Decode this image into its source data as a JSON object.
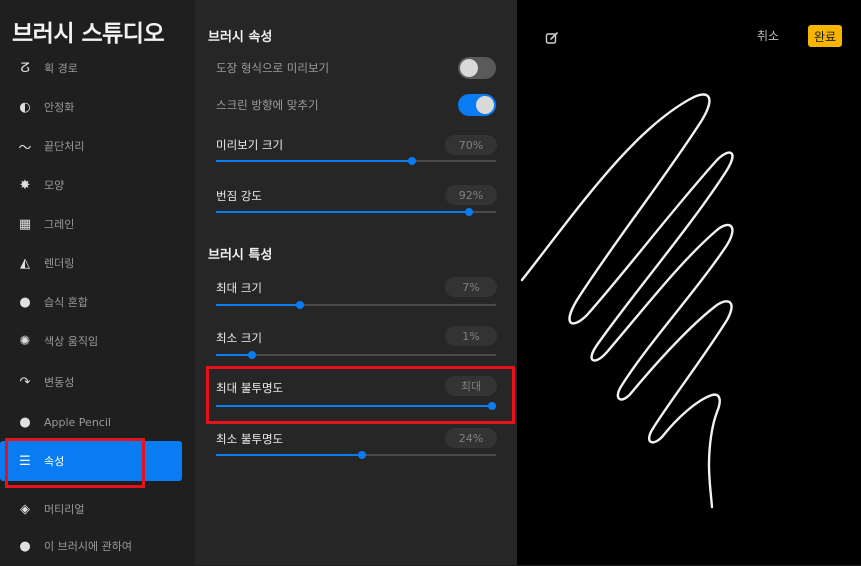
{
  "sidebar": {
    "title": "브러시 스튜디오",
    "items": [
      {
        "label": "획 경로",
        "icon": "stroke-path-icon",
        "glyph": "ⵒ"
      },
      {
        "label": "안정화",
        "icon": "stabilization-icon",
        "glyph": "◐"
      },
      {
        "label": "끝단처리",
        "icon": "taper-icon",
        "glyph": "〜"
      },
      {
        "label": "모양",
        "icon": "shape-icon",
        "glyph": "✸"
      },
      {
        "label": "그레인",
        "icon": "grain-icon",
        "glyph": "▦"
      },
      {
        "label": "렌더링",
        "icon": "rendering-icon",
        "glyph": "◭"
      },
      {
        "label": "습식 혼합",
        "icon": "wet-mix-icon",
        "glyph": "●"
      },
      {
        "label": "색상 움직임",
        "icon": "color-dynamics-icon",
        "glyph": "✺"
      },
      {
        "label": "변동성",
        "icon": "dynamics-icon",
        "glyph": "↷"
      },
      {
        "label": "Apple Pencil",
        "icon": "apple-pencil-icon",
        "glyph": "●"
      },
      {
        "label": "속성",
        "icon": "properties-icon",
        "glyph": "☰"
      },
      {
        "label": "머티리얼",
        "icon": "material-icon",
        "glyph": "◈"
      },
      {
        "label": "이 브러시에 관하여",
        "icon": "about-brush-icon",
        "glyph": "●"
      }
    ]
  },
  "settings": {
    "brush_properties_header": "브러시 속성",
    "stamp_preview_label": "도장 형식으로 미리보기",
    "stamp_preview_on": false,
    "orient_screen_label": "스크린 방향에 맞추기",
    "orient_screen_on": true,
    "preview_size": {
      "label": "미리보기 크기",
      "value_text": "70%",
      "value": 0.7
    },
    "smudge": {
      "label": "번짐 강도",
      "value_text": "92%",
      "value": 0.905
    },
    "brush_behavior_header": "브러시 특성",
    "max_size": {
      "label": "최대 크기",
      "value_text": "7%",
      "value": 0.3
    },
    "min_size": {
      "label": "최소 크기",
      "value_text": "1%",
      "value": 0.13
    },
    "max_opacity": {
      "label": "최대 불투명도",
      "value_text": "최대",
      "value": 0.985
    },
    "min_opacity": {
      "label": "최소 불투명도",
      "value_text": "24%",
      "value": 0.52
    }
  },
  "preview": {
    "cancel_label": "취소",
    "done_label": "완료",
    "edit_icon": "edit-icon"
  },
  "colors": {
    "accent": "#0a7cf3",
    "done": "#f7b500",
    "highlight": "#e5121c"
  }
}
